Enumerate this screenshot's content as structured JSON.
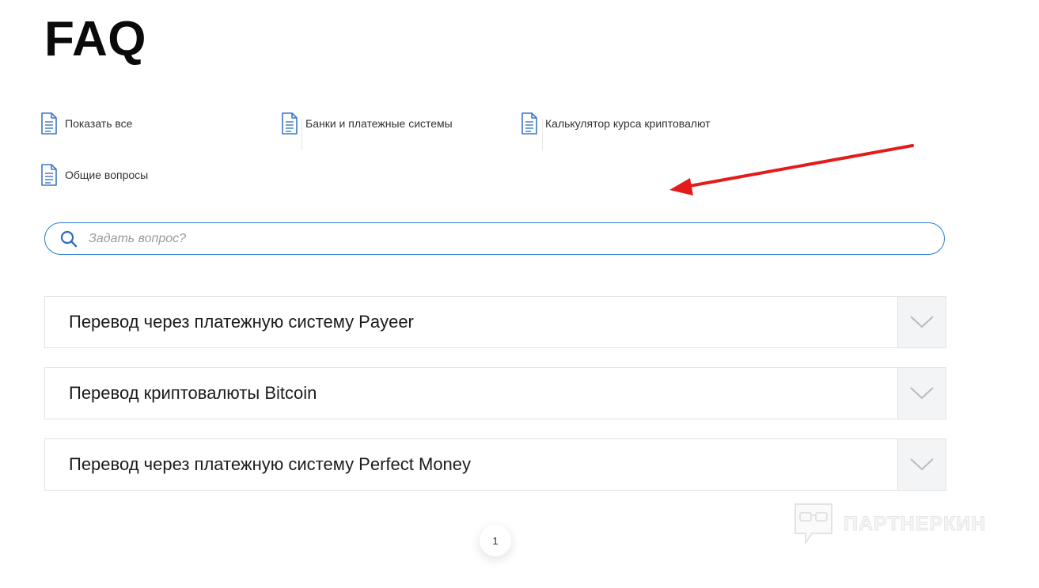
{
  "page": {
    "title": "FAQ"
  },
  "categories": [
    {
      "label": "Показать все",
      "icon": "document-icon"
    },
    {
      "label": "Банки и платежные системы",
      "icon": "document-icon"
    },
    {
      "label": "Калькулятор курса криптовалют",
      "icon": "document-icon"
    },
    {
      "label": "Общие вопросы",
      "icon": "document-icon"
    }
  ],
  "search": {
    "placeholder": "Задать вопрос?",
    "value": "",
    "icon": "search-icon"
  },
  "faq_items": [
    {
      "question": "Перевод через платежную систему Payeer",
      "icon": "chevron-down-icon"
    },
    {
      "question": "Перевод криптовалюты Bitcoin",
      "icon": "chevron-down-icon"
    },
    {
      "question": "Перевод через платежную систему Perfect Money",
      "icon": "chevron-down-icon"
    }
  ],
  "pagination": {
    "current_page": "1"
  },
  "watermark": {
    "text": "ПАРТНЕРКИН"
  },
  "colors": {
    "accent": "#2b7bd6",
    "annotation_arrow": "#e31b1b",
    "toggle_bg": "#f3f4f6",
    "border": "#e3e3e3"
  }
}
